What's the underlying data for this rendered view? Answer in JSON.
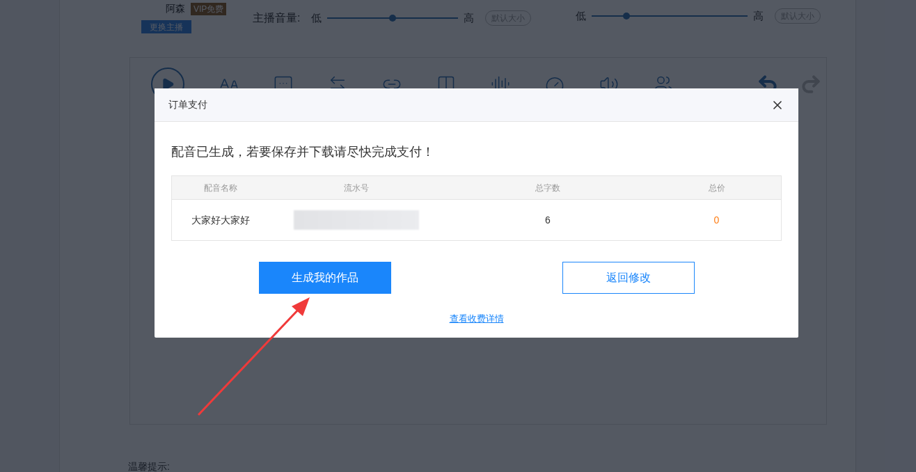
{
  "host": {
    "name": "阿森",
    "badge": "VIP免费",
    "change_button": "更换主播"
  },
  "volume_controls": [
    {
      "label": "主播音量:",
      "low": "低",
      "high": "高",
      "level": 0.5,
      "reset_button": "默认大小"
    },
    {
      "low": "低",
      "high": "高",
      "level": 0.22,
      "reset_button": "默认大小"
    }
  ],
  "tip": "温馨提示:",
  "dialog": {
    "title": "订单支付",
    "message": "配音已生成，若要保存并下载请尽快完成支付！",
    "table": {
      "columns": [
        "配音名称",
        "流水号",
        "总字数",
        "总价"
      ],
      "rows": [
        {
          "name": "大家好大家好",
          "word_count": "6",
          "total_price": "0"
        }
      ]
    },
    "buttons": [
      {
        "kind": "primary",
        "label": "生成我的作品"
      },
      {
        "kind": "secondary",
        "label": "返回修改"
      }
    ],
    "link": "查看收费详情"
  }
}
